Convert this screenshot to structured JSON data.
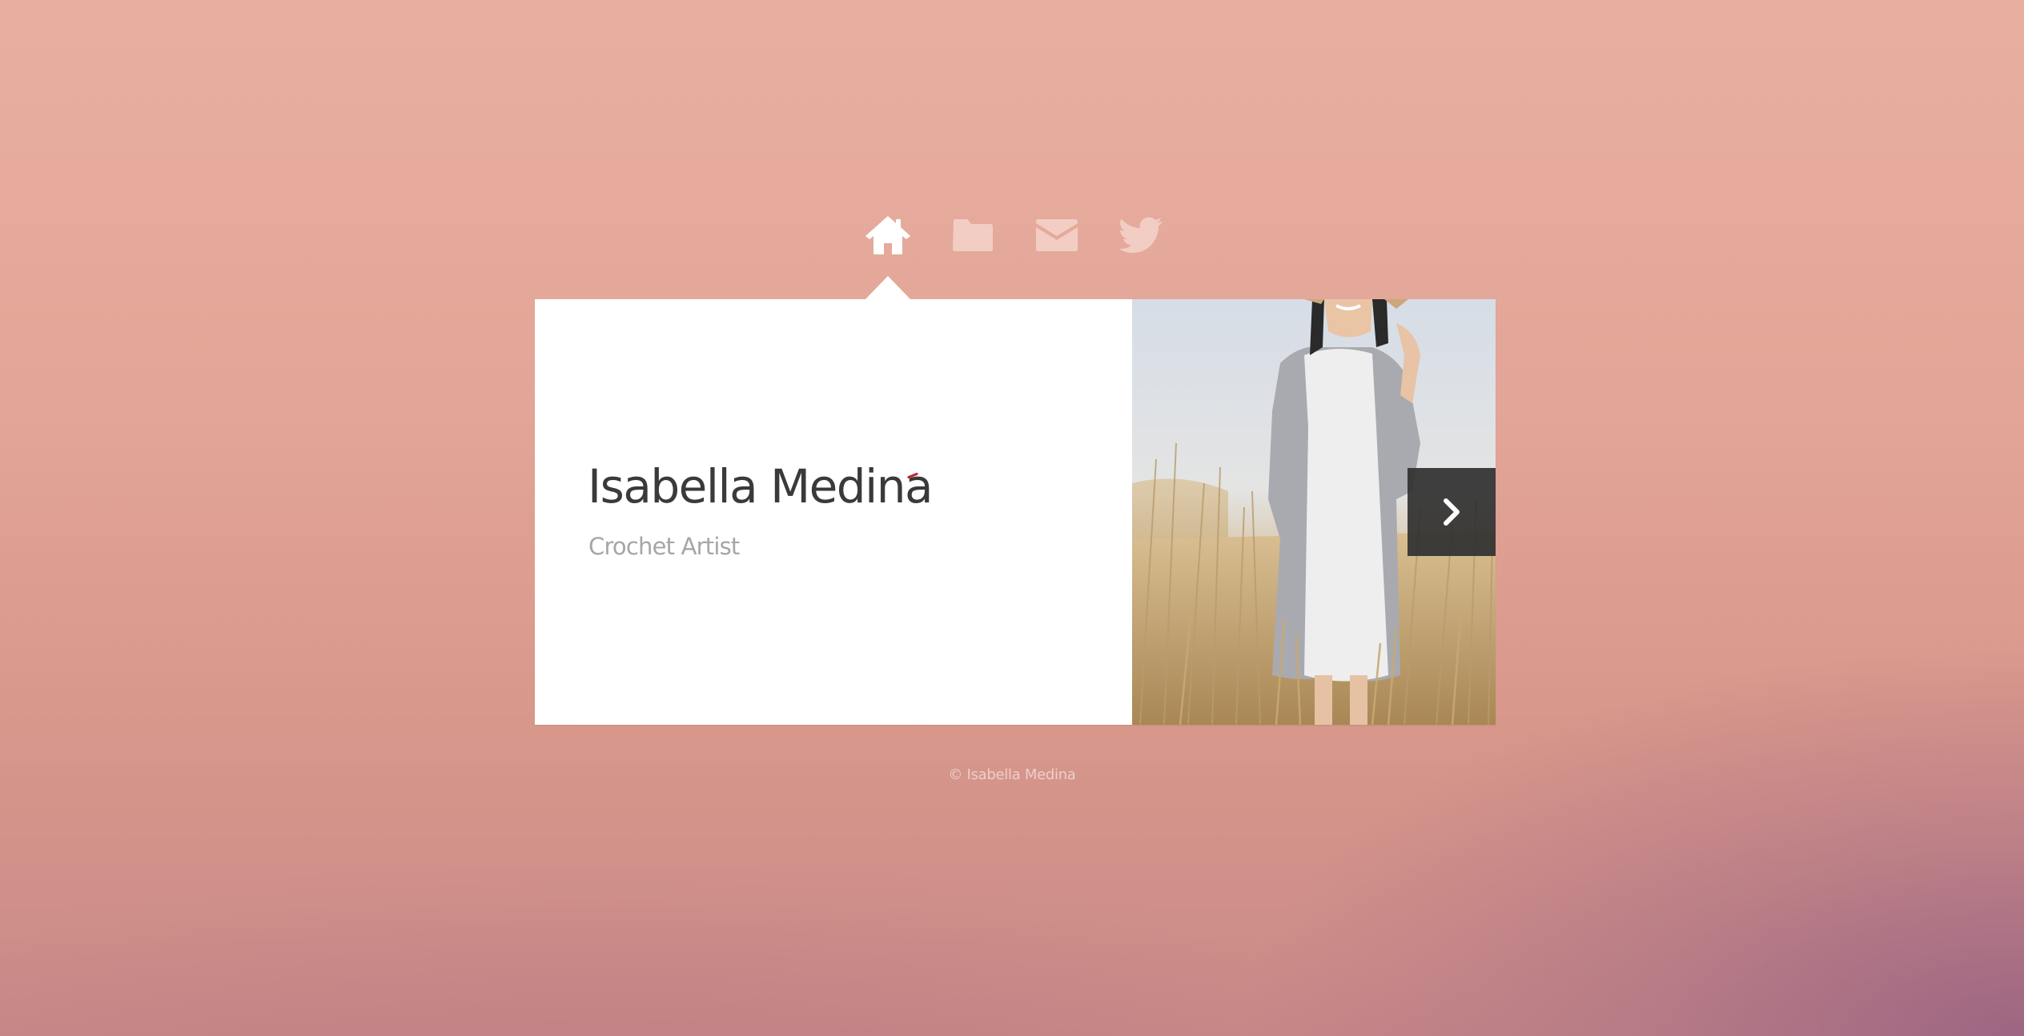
{
  "nav": {
    "items": [
      {
        "icon": "home-icon",
        "active": true
      },
      {
        "icon": "folder-icon",
        "active": false
      },
      {
        "icon": "mail-icon",
        "active": false
      },
      {
        "icon": "twitter-icon",
        "active": false
      }
    ]
  },
  "profile": {
    "name": "Isabella Medina",
    "role": "Crochet Artist"
  },
  "slider": {
    "next_icon": "chevron-right-icon"
  },
  "footer": {
    "copyright": "© Isabella Medina"
  },
  "colors": {
    "accent": "#c0262d",
    "nav_active": "#ffffff",
    "nav_inactive": "#f2cdc3",
    "next_button_bg": "#303030"
  }
}
